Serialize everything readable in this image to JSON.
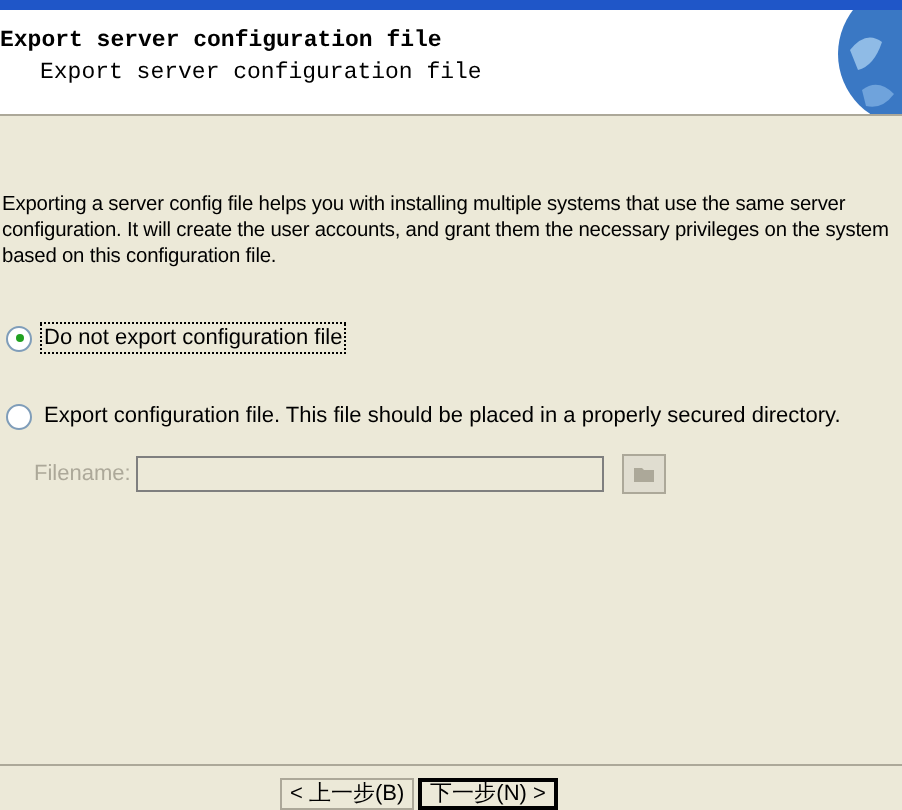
{
  "header": {
    "title": "Export server configuration file",
    "subtitle": "Export server configuration file"
  },
  "description": "Exporting a server config file  helps you with installing multiple systems that use the same server configuration.  It will create the user accounts, and grant them the necessary privileges on the system based on this configuration file.",
  "options": [
    {
      "label": "Do not export configuration file",
      "selected": true
    },
    {
      "label": "Export configuration file. This file should be placed in a properly secured directory.",
      "selected": false
    }
  ],
  "filename": {
    "label": "Filename:",
    "disabled": true
  },
  "buttons": [
    {
      "label": "< 上一步(B)",
      "default": false
    },
    {
      "label": "下一步(N) >",
      "default": true
    }
  ]
}
